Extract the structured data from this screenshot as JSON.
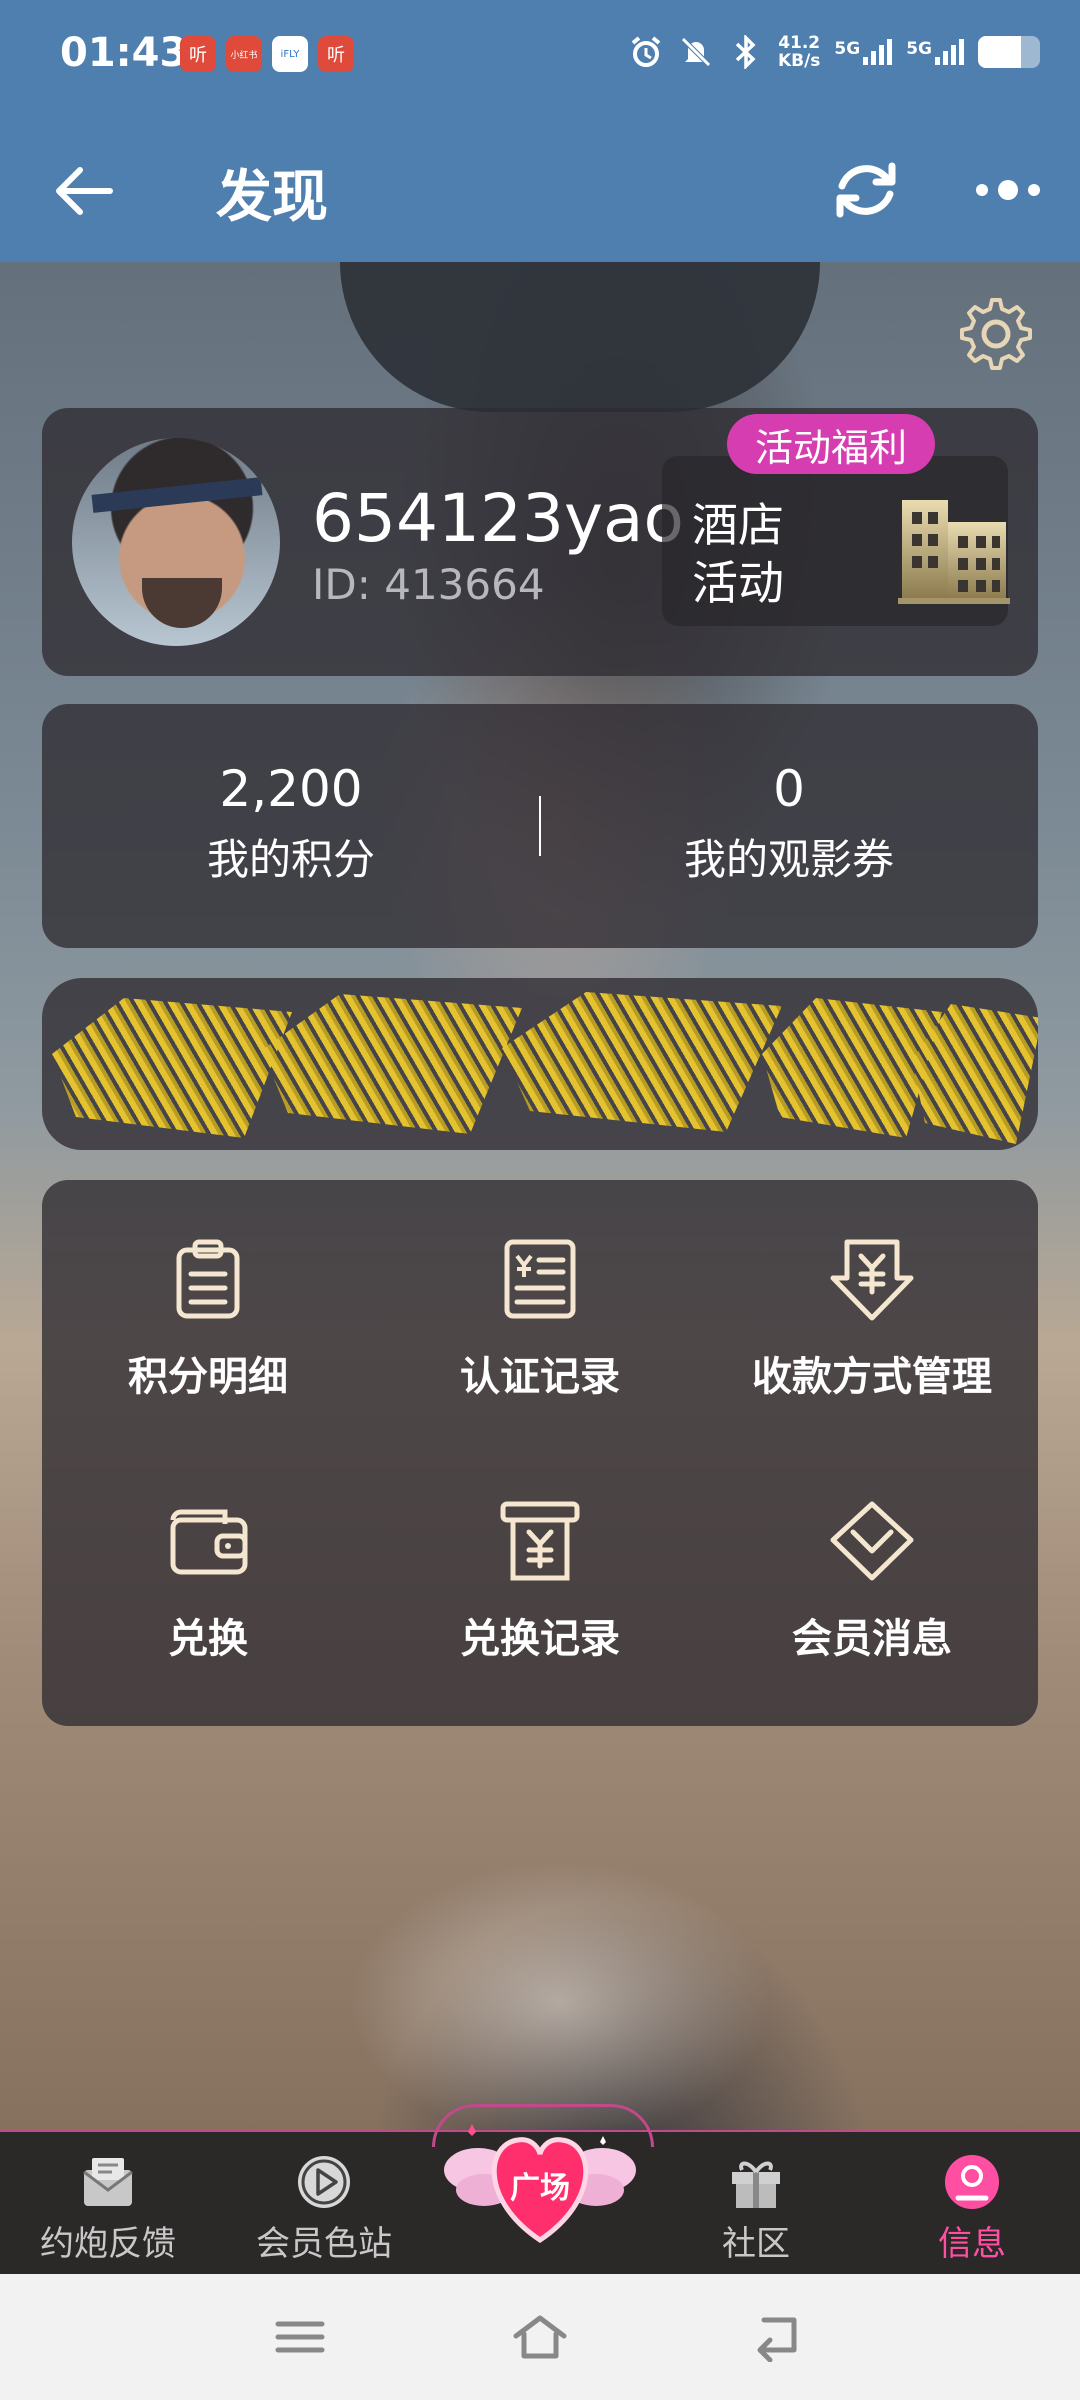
{
  "status_bar": {
    "time": "01:43",
    "notifications": [
      "听",
      "小红书",
      "iFLY",
      "听"
    ],
    "net_speed_value": "41.2",
    "net_speed_unit": "KB/s",
    "signal1_label": "5G",
    "signal2_label": "5G",
    "battery_level": 0.7
  },
  "appbar": {
    "title": "发现"
  },
  "profile": {
    "username": "654123yao",
    "user_id": "ID: 413664",
    "badge": "活动福利",
    "hotel_label": "酒店\n活动"
  },
  "stats": [
    {
      "value": "2,200",
      "label": "我的积分"
    },
    {
      "value": "0",
      "label": "我的观影券"
    }
  ],
  "menu": [
    {
      "label": "积分明细",
      "icon": "clipboard-icon"
    },
    {
      "label": "认证记录",
      "icon": "receipt-list-icon"
    },
    {
      "label": "收款方式管理",
      "icon": "yuan-shield-icon"
    },
    {
      "label": "兑换",
      "icon": "wallet-icon"
    },
    {
      "label": "兑换记录",
      "icon": "yuan-receipt-icon"
    },
    {
      "label": "会员消息",
      "icon": "diamond-chevron-icon"
    }
  ],
  "bottom_nav": [
    {
      "label": "约炮反馈",
      "icon": "mail-icon"
    },
    {
      "label": "会员色站",
      "icon": "play-circle-icon"
    },
    {
      "label": "广场",
      "icon": "heart-wings-icon"
    },
    {
      "label": "社区",
      "icon": "gift-box-icon"
    },
    {
      "label": "信息",
      "icon": "user-circle-icon",
      "active": true
    }
  ],
  "colors": {
    "header": "#4f7fae",
    "card": "#302c32",
    "badge": "#d63db0",
    "active_nav": "#ff4fa3",
    "icon_stroke": "#f4e6cf"
  }
}
